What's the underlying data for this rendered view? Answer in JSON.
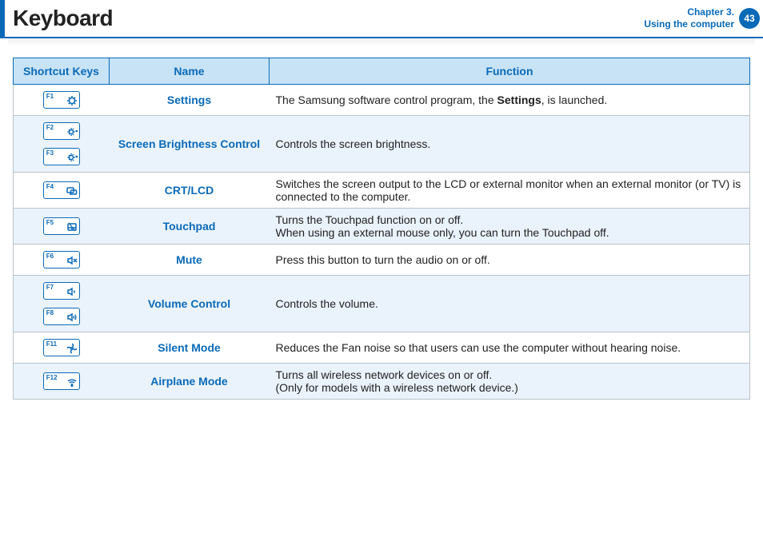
{
  "header": {
    "title": "Keyboard",
    "chapter_line1": "Chapter 3.",
    "chapter_line2": "Using the computer",
    "page_number": "43"
  },
  "table": {
    "col_keys": "Shortcut Keys",
    "col_name": "Name",
    "col_fn": "Function",
    "rows": [
      {
        "keys": [
          "F1"
        ],
        "icons": [
          "settings"
        ],
        "name": "Settings",
        "fn_pre": "The Samsung software control program, the ",
        "fn_bold": "Settings",
        "fn_post": ", is launched.",
        "tint": false
      },
      {
        "keys": [
          "F2",
          "F3"
        ],
        "icons": [
          "bright-down",
          "bright-up"
        ],
        "name": "Screen Brightness Control",
        "fn": "Controls the screen brightness.",
        "tint": true
      },
      {
        "keys": [
          "F4"
        ],
        "icons": [
          "display"
        ],
        "name": "CRT/LCD",
        "fn": "Switches the screen output to the LCD or external monitor when an external monitor (or TV) is connected to the computer.",
        "tint": false
      },
      {
        "keys": [
          "F5"
        ],
        "icons": [
          "touchpad"
        ],
        "name": "Touchpad",
        "fn_line1": "Turns the Touchpad function on or off.",
        "fn_line2": "When using an external mouse only, you can turn the Touchpad off.",
        "tint": true
      },
      {
        "keys": [
          "F6"
        ],
        "icons": [
          "mute"
        ],
        "name": "Mute",
        "fn": "Press this button to turn the audio on or off.",
        "tint": false
      },
      {
        "keys": [
          "F7",
          "F8"
        ],
        "icons": [
          "vol-down",
          "vol-up"
        ],
        "name": "Volume Control",
        "fn": "Controls the volume.",
        "tint": true
      },
      {
        "keys": [
          "F11"
        ],
        "icons": [
          "fan"
        ],
        "name": "Silent Mode",
        "fn": "Reduces the Fan noise so that users can use the computer without hearing noise.",
        "tint": false
      },
      {
        "keys": [
          "F12"
        ],
        "icons": [
          "wifi"
        ],
        "name": "Airplane Mode",
        "fn_line1": "Turns all wireless network devices on or off.",
        "fn_line2": "(Only for models with a wireless network device.)",
        "tint": true
      }
    ]
  }
}
